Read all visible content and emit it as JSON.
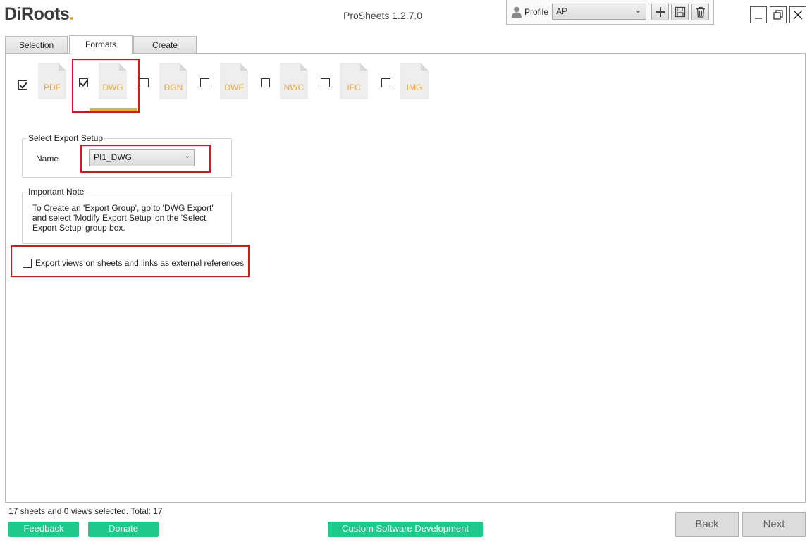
{
  "header": {
    "logo_text": "DiRoots",
    "title": "ProSheets 1.2.7.0",
    "profile_label": "Profile",
    "profile_value": "AP"
  },
  "tabs": [
    {
      "label": "Selection",
      "active": false
    },
    {
      "label": "Formats",
      "active": true
    },
    {
      "label": "Create",
      "active": false
    }
  ],
  "formats": [
    {
      "label": "PDF",
      "checked": true
    },
    {
      "label": "DWG",
      "checked": true
    },
    {
      "label": "DGN",
      "checked": false
    },
    {
      "label": "DWF",
      "checked": false
    },
    {
      "label": "NWC",
      "checked": false
    },
    {
      "label": "IFC",
      "checked": false
    },
    {
      "label": "IMG",
      "checked": false
    }
  ],
  "export_setup": {
    "group_title": "Select Export Setup",
    "name_label": "Name",
    "name_value": "PI1_DWG"
  },
  "note": {
    "group_title": "Important Note",
    "text": "To Create an 'Export Group', go to 'DWG Export' and select 'Modify Export Setup' on the 'Select Export Setup' group box."
  },
  "external_refs": {
    "label": "Export views on sheets and links as external references",
    "checked": false
  },
  "footer": {
    "status": "17 sheets and 0 views selected. Total: 17",
    "feedback": "Feedback",
    "donate": "Donate",
    "custom_dev": "Custom Software Development",
    "back": "Back",
    "next": "Next"
  },
  "colors": {
    "accent": "#f0a830",
    "highlight": "#e0121a",
    "green": "#1ec98c"
  }
}
